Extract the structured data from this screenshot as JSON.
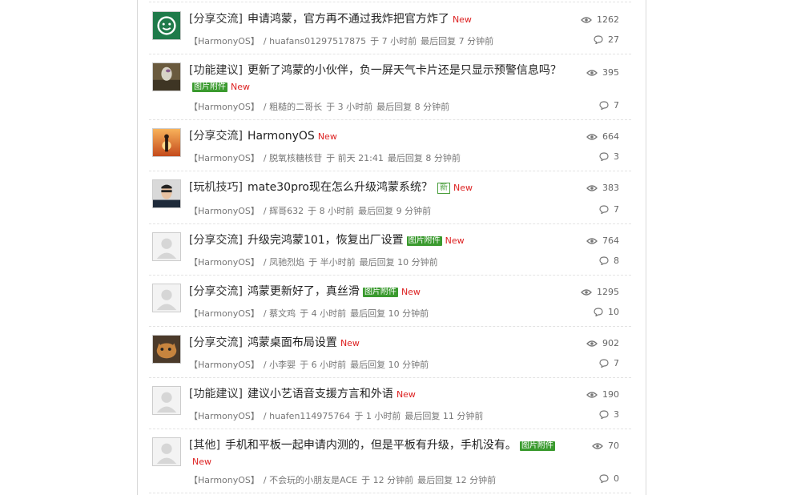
{
  "threads": [
    {
      "tag": "[分享交流]",
      "title": "申请鸿蒙，官方再不通过我炸把官方炸了",
      "badge": "",
      "new_label": "New",
      "board": "【HarmonyOS】",
      "author": "/ huafans01297517875",
      "posted": "于 7 小时前",
      "last_reply": "最后回复 7 分钟前",
      "views": "1262",
      "replies": "27"
    },
    {
      "tag": "[功能建议]",
      "title": "更新了鸿蒙的小伙伴，负一屏天气卡片还是只显示预警信息吗？",
      "badge": "图片附件",
      "new_label": "New",
      "board": "【HarmonyOS】",
      "author": "/ 粗糙的二哥长",
      "posted": "于 3 小时前",
      "last_reply": "最后回复 8 分钟前",
      "views": "395",
      "replies": "7"
    },
    {
      "tag": "[分享交流]",
      "title": "HarmonyOS",
      "badge": "",
      "new_label": "New",
      "board": "【HarmonyOS】",
      "author": "/ 脱氧核糖核苷",
      "posted": "于 前天 21:41",
      "last_reply": "最后回复 8 分钟前",
      "views": "664",
      "replies": "3"
    },
    {
      "tag": "[玩机技巧]",
      "title": "mate30pro现在怎么升级鸿蒙系统？",
      "badge": "新",
      "new_label": "New",
      "board": "【HarmonyOS】",
      "author": "/ 辉哥632",
      "posted": "于 8 小时前",
      "last_reply": "最后回复 9 分钟前",
      "views": "383",
      "replies": "7"
    },
    {
      "tag": "[分享交流]",
      "title": "升级完鸿蒙101，恢复出厂设置",
      "badge": "图片附件",
      "new_label": "New",
      "board": "【HarmonyOS】",
      "author": "/ 凤驰烈焰",
      "posted": "于 半小时前",
      "last_reply": "最后回复 10 分钟前",
      "views": "764",
      "replies": "8"
    },
    {
      "tag": "[分享交流]",
      "title": "鸿蒙更新好了，真丝滑",
      "badge": "图片附件",
      "new_label": "New",
      "board": "【HarmonyOS】",
      "author": "/ 蔡文鸡",
      "posted": "于 4 小时前",
      "last_reply": "最后回复 10 分钟前",
      "views": "1295",
      "replies": "10"
    },
    {
      "tag": "[分享交流]",
      "title": "鸿蒙桌面布局设置",
      "badge": "",
      "new_label": "New",
      "board": "【HarmonyOS】",
      "author": "/ 小李婴",
      "posted": "于 6 小时前",
      "last_reply": "最后回复 10 分钟前",
      "views": "902",
      "replies": "7"
    },
    {
      "tag": "[功能建议]",
      "title": "建议小艺语音支援方言和外语",
      "badge": "",
      "new_label": "New",
      "board": "【HarmonyOS】",
      "author": "/ huafen114975764",
      "posted": "于 1 小时前",
      "last_reply": "最后回复 11 分钟前",
      "views": "190",
      "replies": "3"
    },
    {
      "tag": "[其他]",
      "title": "手机和平板一起申请内测的，但是平板有升级，手机没有。",
      "badge": "图片附件",
      "new_label": "New",
      "board": "【HarmonyOS】",
      "author": "/ 不会玩的小朋友是ACE",
      "posted": "于 12 分钟前",
      "last_reply": "最后回复 12 分钟前",
      "views": "70",
      "replies": "0"
    }
  ],
  "icons": {
    "views": "eye-icon",
    "replies": "comment-icon"
  },
  "colors": {
    "new": "#dd2222",
    "badge_green": "#3a9a2e"
  }
}
